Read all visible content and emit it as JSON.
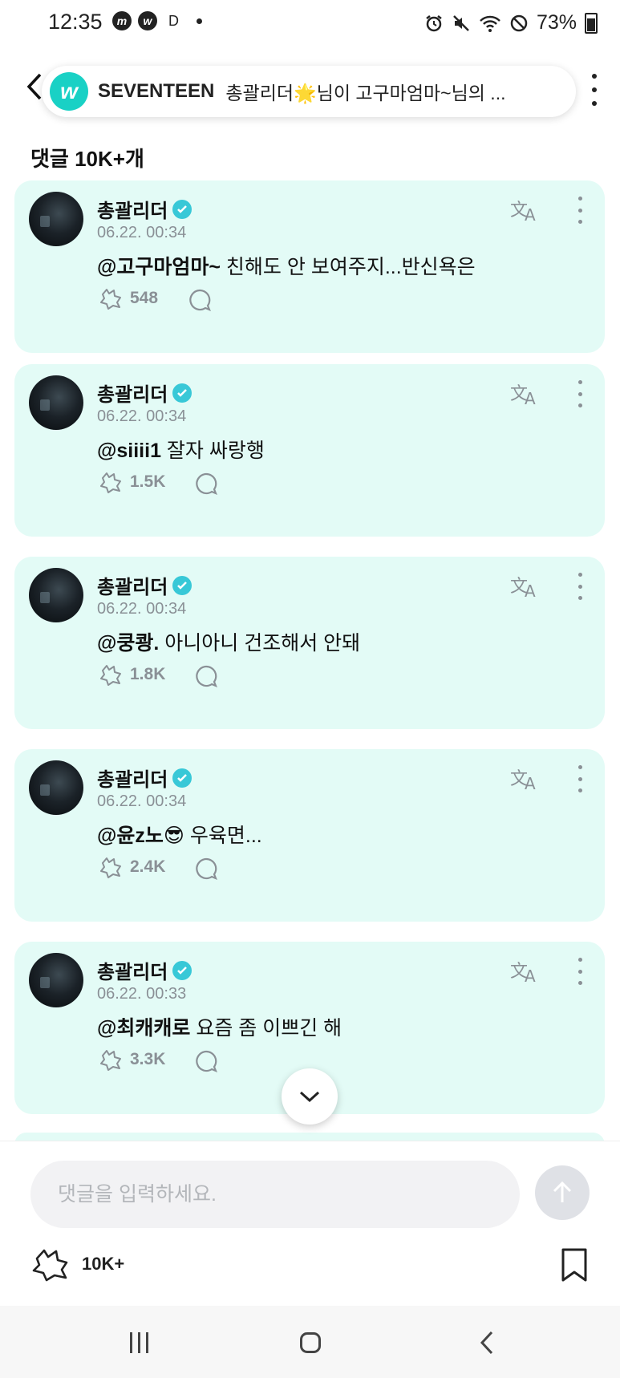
{
  "status_bar": {
    "time": "12:35",
    "app_icons": [
      "m",
      "w"
    ],
    "letter": "D",
    "battery": "73%"
  },
  "header": {
    "logo_letter": "w",
    "title": "SEVENTEEN",
    "subtitle": "총괄리더🌟님이 고구마엄마~님의 ..."
  },
  "comment_count_label": "댓글 10K+개",
  "comments": [
    {
      "author": "총괄리더",
      "date": "06.22. 00:34",
      "mention": "@고구마엄마~",
      "text": " 친해도 안 보여주지...반신욕은",
      "likes": "548"
    },
    {
      "author": "총괄리더",
      "date": "06.22. 00:34",
      "mention": "@siiii1",
      "text": " 잘자 싸랑행",
      "likes": "1.5K"
    },
    {
      "author": "총괄리더",
      "date": "06.22. 00:34",
      "mention": "@쿵쾅.",
      "text": " 아니아니 건조해서 안돼",
      "likes": "1.8K"
    },
    {
      "author": "총괄리더",
      "date": "06.22. 00:34",
      "mention": "@윤z노😎",
      "text": " 우육면...",
      "likes": "2.4K"
    },
    {
      "author": "총괄리더",
      "date": "06.22. 00:33",
      "mention": "@최캐캐로",
      "text": " 요즘 좀 이쁘긴 해",
      "likes": "3.3K"
    }
  ],
  "input": {
    "placeholder": "댓글을 입력하세요."
  },
  "footer": {
    "like_count": "10K+"
  },
  "colors": {
    "card_bg": "#e3fbf6",
    "brand": "#19d1c5",
    "verified": "#38c8d7",
    "muted": "#8a9096"
  }
}
